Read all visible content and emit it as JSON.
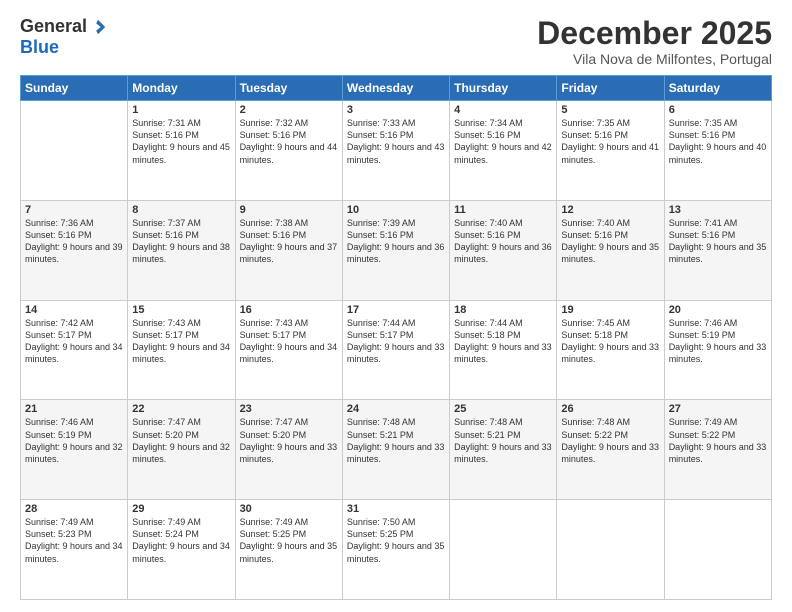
{
  "logo": {
    "general": "General",
    "blue": "Blue"
  },
  "header": {
    "month": "December 2025",
    "location": "Vila Nova de Milfontes, Portugal"
  },
  "days": [
    "Sunday",
    "Monday",
    "Tuesday",
    "Wednesday",
    "Thursday",
    "Friday",
    "Saturday"
  ],
  "weeks": [
    [
      {
        "day": "",
        "sunrise": "",
        "sunset": "",
        "daylight": ""
      },
      {
        "day": "1",
        "sunrise": "Sunrise: 7:31 AM",
        "sunset": "Sunset: 5:16 PM",
        "daylight": "Daylight: 9 hours and 45 minutes."
      },
      {
        "day": "2",
        "sunrise": "Sunrise: 7:32 AM",
        "sunset": "Sunset: 5:16 PM",
        "daylight": "Daylight: 9 hours and 44 minutes."
      },
      {
        "day": "3",
        "sunrise": "Sunrise: 7:33 AM",
        "sunset": "Sunset: 5:16 PM",
        "daylight": "Daylight: 9 hours and 43 minutes."
      },
      {
        "day": "4",
        "sunrise": "Sunrise: 7:34 AM",
        "sunset": "Sunset: 5:16 PM",
        "daylight": "Daylight: 9 hours and 42 minutes."
      },
      {
        "day": "5",
        "sunrise": "Sunrise: 7:35 AM",
        "sunset": "Sunset: 5:16 PM",
        "daylight": "Daylight: 9 hours and 41 minutes."
      },
      {
        "day": "6",
        "sunrise": "Sunrise: 7:35 AM",
        "sunset": "Sunset: 5:16 PM",
        "daylight": "Daylight: 9 hours and 40 minutes."
      }
    ],
    [
      {
        "day": "7",
        "sunrise": "Sunrise: 7:36 AM",
        "sunset": "Sunset: 5:16 PM",
        "daylight": "Daylight: 9 hours and 39 minutes."
      },
      {
        "day": "8",
        "sunrise": "Sunrise: 7:37 AM",
        "sunset": "Sunset: 5:16 PM",
        "daylight": "Daylight: 9 hours and 38 minutes."
      },
      {
        "day": "9",
        "sunrise": "Sunrise: 7:38 AM",
        "sunset": "Sunset: 5:16 PM",
        "daylight": "Daylight: 9 hours and 37 minutes."
      },
      {
        "day": "10",
        "sunrise": "Sunrise: 7:39 AM",
        "sunset": "Sunset: 5:16 PM",
        "daylight": "Daylight: 9 hours and 36 minutes."
      },
      {
        "day": "11",
        "sunrise": "Sunrise: 7:40 AM",
        "sunset": "Sunset: 5:16 PM",
        "daylight": "Daylight: 9 hours and 36 minutes."
      },
      {
        "day": "12",
        "sunrise": "Sunrise: 7:40 AM",
        "sunset": "Sunset: 5:16 PM",
        "daylight": "Daylight: 9 hours and 35 minutes."
      },
      {
        "day": "13",
        "sunrise": "Sunrise: 7:41 AM",
        "sunset": "Sunset: 5:16 PM",
        "daylight": "Daylight: 9 hours and 35 minutes."
      }
    ],
    [
      {
        "day": "14",
        "sunrise": "Sunrise: 7:42 AM",
        "sunset": "Sunset: 5:17 PM",
        "daylight": "Daylight: 9 hours and 34 minutes."
      },
      {
        "day": "15",
        "sunrise": "Sunrise: 7:43 AM",
        "sunset": "Sunset: 5:17 PM",
        "daylight": "Daylight: 9 hours and 34 minutes."
      },
      {
        "day": "16",
        "sunrise": "Sunrise: 7:43 AM",
        "sunset": "Sunset: 5:17 PM",
        "daylight": "Daylight: 9 hours and 34 minutes."
      },
      {
        "day": "17",
        "sunrise": "Sunrise: 7:44 AM",
        "sunset": "Sunset: 5:17 PM",
        "daylight": "Daylight: 9 hours and 33 minutes."
      },
      {
        "day": "18",
        "sunrise": "Sunrise: 7:44 AM",
        "sunset": "Sunset: 5:18 PM",
        "daylight": "Daylight: 9 hours and 33 minutes."
      },
      {
        "day": "19",
        "sunrise": "Sunrise: 7:45 AM",
        "sunset": "Sunset: 5:18 PM",
        "daylight": "Daylight: 9 hours and 33 minutes."
      },
      {
        "day": "20",
        "sunrise": "Sunrise: 7:46 AM",
        "sunset": "Sunset: 5:19 PM",
        "daylight": "Daylight: 9 hours and 33 minutes."
      }
    ],
    [
      {
        "day": "21",
        "sunrise": "Sunrise: 7:46 AM",
        "sunset": "Sunset: 5:19 PM",
        "daylight": "Daylight: 9 hours and 32 minutes."
      },
      {
        "day": "22",
        "sunrise": "Sunrise: 7:47 AM",
        "sunset": "Sunset: 5:20 PM",
        "daylight": "Daylight: 9 hours and 32 minutes."
      },
      {
        "day": "23",
        "sunrise": "Sunrise: 7:47 AM",
        "sunset": "Sunset: 5:20 PM",
        "daylight": "Daylight: 9 hours and 33 minutes."
      },
      {
        "day": "24",
        "sunrise": "Sunrise: 7:48 AM",
        "sunset": "Sunset: 5:21 PM",
        "daylight": "Daylight: 9 hours and 33 minutes."
      },
      {
        "day": "25",
        "sunrise": "Sunrise: 7:48 AM",
        "sunset": "Sunset: 5:21 PM",
        "daylight": "Daylight: 9 hours and 33 minutes."
      },
      {
        "day": "26",
        "sunrise": "Sunrise: 7:48 AM",
        "sunset": "Sunset: 5:22 PM",
        "daylight": "Daylight: 9 hours and 33 minutes."
      },
      {
        "day": "27",
        "sunrise": "Sunrise: 7:49 AM",
        "sunset": "Sunset: 5:22 PM",
        "daylight": "Daylight: 9 hours and 33 minutes."
      }
    ],
    [
      {
        "day": "28",
        "sunrise": "Sunrise: 7:49 AM",
        "sunset": "Sunset: 5:23 PM",
        "daylight": "Daylight: 9 hours and 34 minutes."
      },
      {
        "day": "29",
        "sunrise": "Sunrise: 7:49 AM",
        "sunset": "Sunset: 5:24 PM",
        "daylight": "Daylight: 9 hours and 34 minutes."
      },
      {
        "day": "30",
        "sunrise": "Sunrise: 7:49 AM",
        "sunset": "Sunset: 5:25 PM",
        "daylight": "Daylight: 9 hours and 35 minutes."
      },
      {
        "day": "31",
        "sunrise": "Sunrise: 7:50 AM",
        "sunset": "Sunset: 5:25 PM",
        "daylight": "Daylight: 9 hours and 35 minutes."
      },
      {
        "day": "",
        "sunrise": "",
        "sunset": "",
        "daylight": ""
      },
      {
        "day": "",
        "sunrise": "",
        "sunset": "",
        "daylight": ""
      },
      {
        "day": "",
        "sunrise": "",
        "sunset": "",
        "daylight": ""
      }
    ]
  ]
}
